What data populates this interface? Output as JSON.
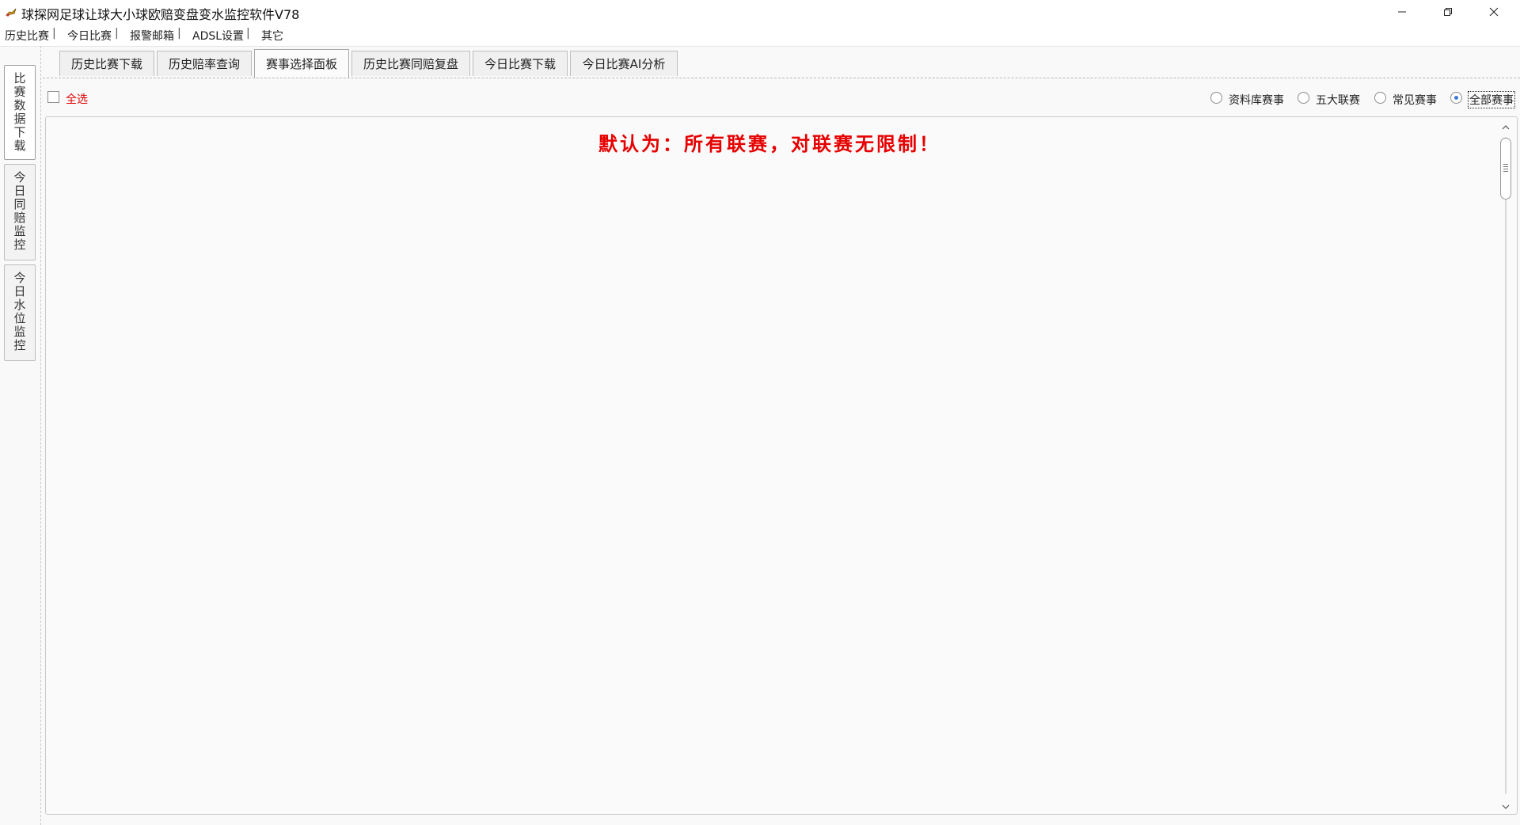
{
  "window": {
    "title": "球探网足球让球大小球欧赔变盘变水监控软件V78",
    "app_icon": "rocket-icon",
    "controls": [
      "minimize-icon",
      "restore-icon",
      "close-icon"
    ]
  },
  "menubar": {
    "items": [
      {
        "label": "历史比赛",
        "sep": "|"
      },
      {
        "label": "今日比赛",
        "sep": "|"
      },
      {
        "label": "报警邮箱",
        "sep": "|"
      },
      {
        "label": "ADSL设置",
        "sep": "|"
      },
      {
        "label": "其它"
      }
    ]
  },
  "vertical_tabs": [
    {
      "label": "比赛数据下载",
      "active": true
    },
    {
      "label": "今日同赔监控",
      "active": false
    },
    {
      "label": "今日水位监控",
      "active": false
    }
  ],
  "tabs": [
    {
      "label": "历史比赛下载",
      "active": false
    },
    {
      "label": "历史赔率查询",
      "active": false
    },
    {
      "label": "赛事选择面板",
      "active": true
    },
    {
      "label": "历史比赛同赔复盘",
      "active": false
    },
    {
      "label": "今日比赛下载",
      "active": false
    },
    {
      "label": "今日比赛AI分析",
      "active": false
    }
  ],
  "select_all": {
    "label": "全选",
    "checked": false
  },
  "filters": {
    "options": [
      "资料库赛事",
      "五大联赛",
      "常见赛事",
      "全部赛事"
    ],
    "selected": "全部赛事"
  },
  "panel": {
    "notice": "默认为：所有联赛，对联赛无限制！"
  },
  "colors": {
    "notice": "#e60000",
    "select_all_label": "#e00000",
    "background": "#f9f9f9",
    "radio_selected": "#3b78d8"
  }
}
